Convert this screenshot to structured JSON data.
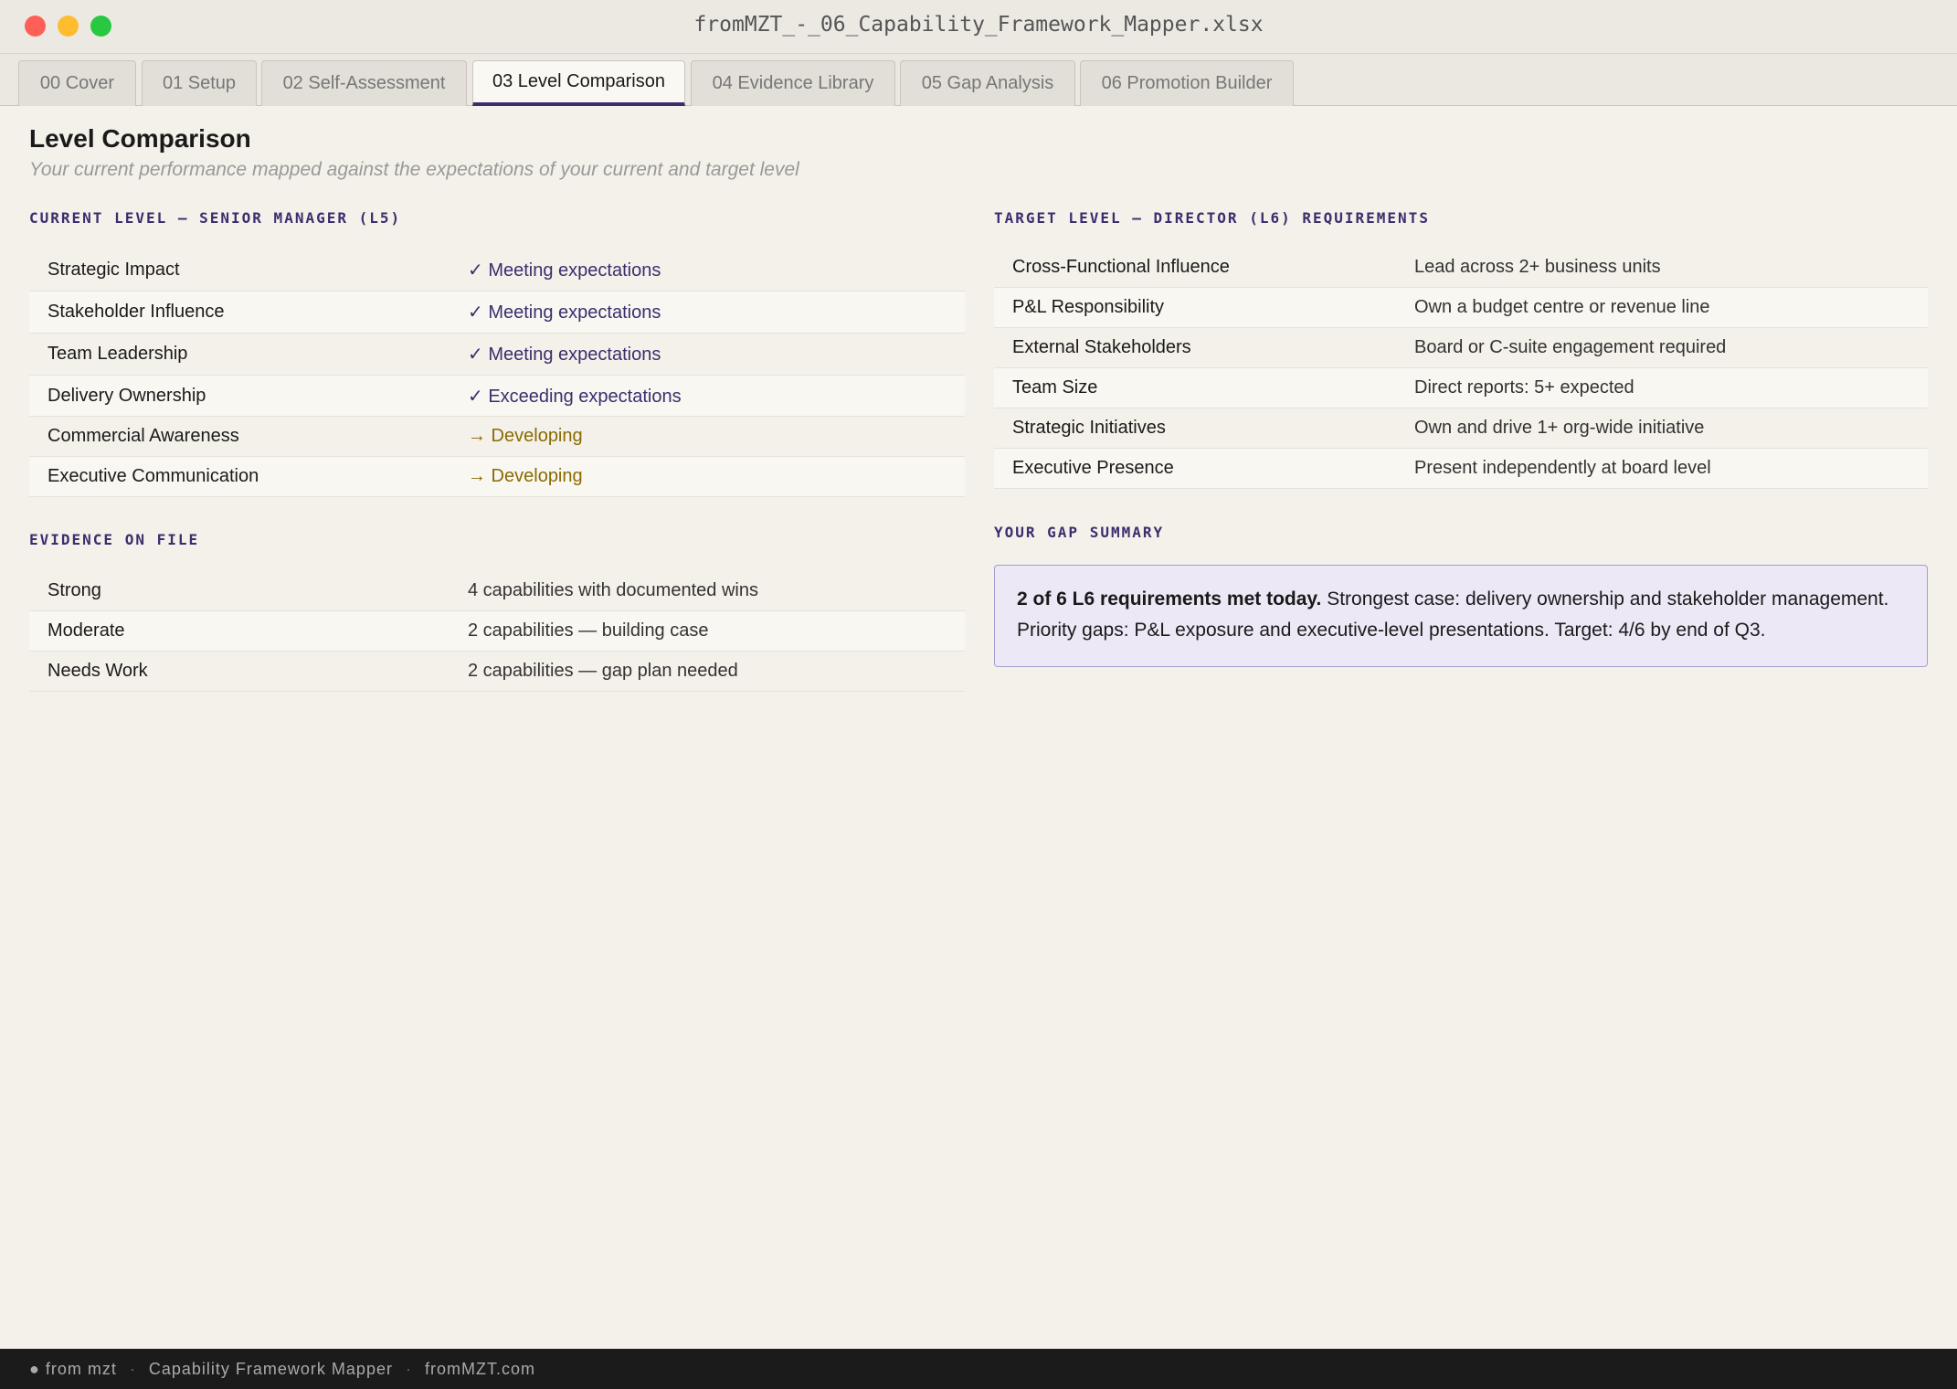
{
  "window": {
    "title": "fromMZT_-_06_Capability_Framework_Mapper.xlsx"
  },
  "tabs": [
    {
      "label": "00 Cover"
    },
    {
      "label": "01 Setup"
    },
    {
      "label": "02 Self-Assessment"
    },
    {
      "label": "03 Level Comparison"
    },
    {
      "label": "04 Evidence Library"
    },
    {
      "label": "05 Gap Analysis"
    },
    {
      "label": "06 Promotion Builder"
    }
  ],
  "page": {
    "title": "Level Comparison",
    "subtitle": "Your current performance mapped against the expectations of your current and target level"
  },
  "current_level": {
    "heading": "CURRENT LEVEL — SENIOR MANAGER (L5)",
    "rows": [
      {
        "label": "Strategic Impact",
        "status": "✓ Meeting expectations",
        "kind": "meet"
      },
      {
        "label": "Stakeholder Influence",
        "status": "✓ Meeting expectations",
        "kind": "meet"
      },
      {
        "label": "Team Leadership",
        "status": "✓ Meeting expectations",
        "kind": "meet"
      },
      {
        "label": "Delivery Ownership",
        "status": "✓ Exceeding expectations",
        "kind": "meet"
      },
      {
        "label": "Commercial Awareness",
        "status": "→ Developing",
        "kind": "dev"
      },
      {
        "label": "Executive Communication",
        "status": "→ Developing",
        "kind": "dev"
      }
    ]
  },
  "evidence": {
    "heading": "EVIDENCE ON FILE",
    "rows": [
      {
        "label": "Strong",
        "value": "4 capabilities with documented wins"
      },
      {
        "label": "Moderate",
        "value": "2 capabilities — building case"
      },
      {
        "label": "Needs Work",
        "value": "2 capabilities — gap plan needed"
      }
    ]
  },
  "target_level": {
    "heading": "TARGET LEVEL — DIRECTOR (L6) REQUIREMENTS",
    "rows": [
      {
        "label": "Cross-Functional Influence",
        "value": "Lead across 2+ business units"
      },
      {
        "label": "P&L Responsibility",
        "value": "Own a budget centre or revenue line"
      },
      {
        "label": "External Stakeholders",
        "value": "Board or C-suite engagement required"
      },
      {
        "label": "Team Size",
        "value": "Direct reports: 5+ expected"
      },
      {
        "label": "Strategic Initiatives",
        "value": "Own and drive 1+ org-wide initiative"
      },
      {
        "label": "Executive Presence",
        "value": "Present independently at board level"
      }
    ]
  },
  "gap_summary": {
    "heading": "YOUR GAP SUMMARY",
    "bold": "2 of 6 L6 requirements met today.",
    "text": " Strongest case: delivery ownership and stakeholder management. Priority gaps: P&L exposure and executive-level presentations. Target: 4/6 by end of Q3."
  },
  "footer": {
    "brand": "● from mzt",
    "sep": "·",
    "product": "Capability Framework Mapper",
    "site": "fromMZT.com"
  }
}
